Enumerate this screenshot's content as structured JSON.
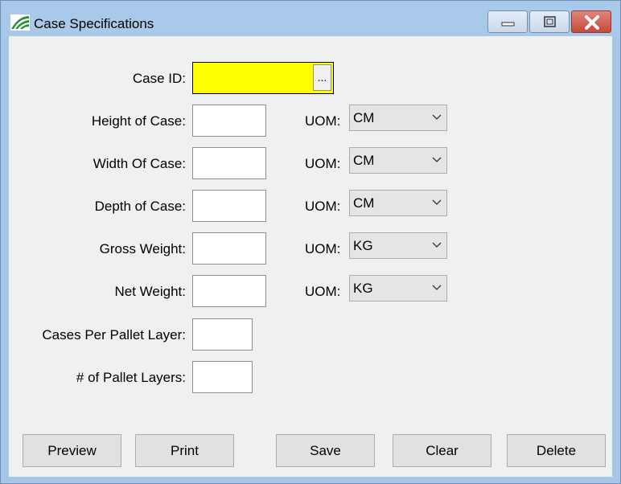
{
  "window": {
    "title": "Case Specifications"
  },
  "form": {
    "case_id_label": "Case ID:",
    "case_id_value": "",
    "browse_label": "...",
    "height_label": "Height of Case:",
    "width_label": "Width Of Case:",
    "depth_label": "Depth of Case:",
    "gross_weight_label": "Gross Weight:",
    "net_weight_label": "Net Weight:",
    "cases_per_layer_label": "Cases Per Pallet Layer:",
    "pallet_layers_label": "# of Pallet Layers:",
    "uom_label": "UOM:",
    "height_uom": "CM",
    "width_uom": "CM",
    "depth_uom": "CM",
    "gross_weight_uom": "KG",
    "net_weight_uom": "KG"
  },
  "buttons": {
    "preview": "Preview",
    "print": "Print",
    "save": "Save",
    "clear": "Clear",
    "delete": "Delete"
  },
  "colors": {
    "case_id_highlight": "#ffff00",
    "titlebar": "#a8c9ea",
    "close_button": "#c44a3b"
  }
}
